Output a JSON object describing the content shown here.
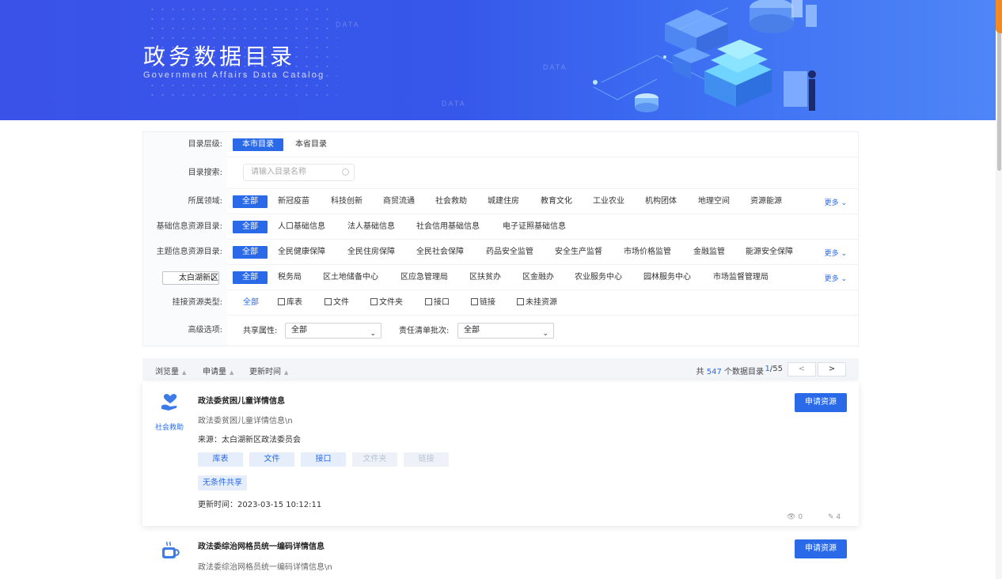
{
  "banner": {
    "title": "政务数据目录",
    "subtitle": "Government Affairs Data Catalog",
    "deco_words": [
      "DATA",
      "DATA",
      "DATA"
    ]
  },
  "filters": {
    "level": {
      "label": "目录层级:",
      "options": [
        "本市目录",
        "本省目录"
      ],
      "active": "本市目录"
    },
    "search": {
      "label": "目录搜索:",
      "placeholder": "请输入目录名称"
    },
    "domain": {
      "label": "所属领域:",
      "options": [
        "全部",
        "新冠疫苗",
        "科技创新",
        "商贸流通",
        "社会救助",
        "城建住房",
        "教育文化",
        "工业农业",
        "机构团体",
        "地理空间",
        "资源能源"
      ],
      "more": "更多"
    },
    "basic": {
      "label": "基础信息资源目录:",
      "options": [
        "全部",
        "人口基础信息",
        "法人基础信息",
        "社会信用基础信息",
        "电子证照基础信息"
      ]
    },
    "theme": {
      "label": "主题信息资源目录:",
      "options": [
        "全部",
        "全民健康保障",
        "全民住房保障",
        "全民社会保障",
        "药品安全监管",
        "安全生产监督",
        "市场价格监管",
        "金融监管",
        "能源安全保障"
      ],
      "more": "更多"
    },
    "district": {
      "select": "太白湖新区",
      "options": [
        "全部",
        "税务局",
        "区土地储备中心",
        "区应急管理局",
        "区扶贫办",
        "区金融办",
        "农业服务中心",
        "园林服务中心",
        "市场监督管理局"
      ],
      "more": "更多"
    },
    "type": {
      "label": "挂接资源类型:",
      "all": "全部",
      "options": [
        "库表",
        "文件",
        "文件夹",
        "接口",
        "链接",
        "未挂资源"
      ]
    },
    "advanced": {
      "label": "高级选项:",
      "share_label": "共享属性:",
      "share_value": "全部",
      "batch_label": "责任清单批次:",
      "batch_value": "全部"
    }
  },
  "sortbar": {
    "sorts": [
      "浏览量",
      "申请量",
      "更新时间"
    ],
    "count_prefix": "共",
    "count": "547",
    "count_suffix": "个数据目录",
    "page": "1",
    "page_total": "/55",
    "prev": "<",
    "next": ">"
  },
  "items": [
    {
      "category": "社会救助",
      "title": "政法委贫困儿童详情信息",
      "desc": "政法委贫困儿童详情信息\\n",
      "source": "来源：太白湖新区政法委员会",
      "tags": [
        {
          "label": "库表",
          "enabled": true
        },
        {
          "label": "文件",
          "enabled": true
        },
        {
          "label": "接口",
          "enabled": true
        },
        {
          "label": "文件夹",
          "enabled": false
        },
        {
          "label": "链接",
          "enabled": false
        }
      ],
      "share": "无条件共享",
      "updated": "更新时间：2023-03-15 10:12:11",
      "views": "0",
      "applies": "4",
      "apply_label": "申请资源"
    },
    {
      "title": "政法委综治网格员统一编码详情信息",
      "desc": "政法委综治网格员统一编码详情信息\\n",
      "apply_label": "申请资源"
    }
  ],
  "colors": {
    "accent": "#2a6ae8",
    "banner": "#3657ea"
  }
}
